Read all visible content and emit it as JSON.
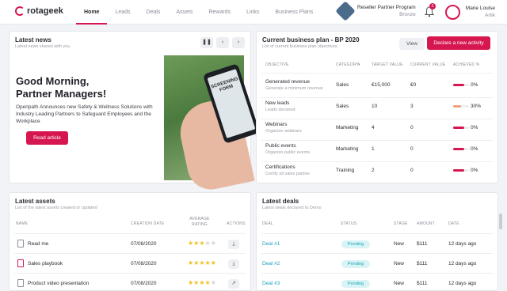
{
  "brand": {
    "name": "rotageek",
    "color": "#d6174f"
  },
  "nav": {
    "items": [
      "Home",
      "Leads",
      "Deals",
      "Assets",
      "Rewards",
      "Links",
      "Business Plans"
    ],
    "active": "Home"
  },
  "partner": {
    "program": "Reseller Partner Program",
    "level": "Bronze"
  },
  "notifications": {
    "count": "3"
  },
  "user": {
    "name": "Marie Louise",
    "company": "Artik"
  },
  "news": {
    "title": "Latest news",
    "subtitle": "Latest news shared with you",
    "headline_1": "Good Morning,",
    "headline_2": "Partner Managers!",
    "body": "Openpath Announces new Safety & Wellness Solutions with Industry Leading Partners to Safeguard Employees and the Workplace",
    "cta": "Read article",
    "image_caption": "SCREENING FORM",
    "controls": {
      "pause": "pause-icon",
      "prev": "chevron-left-icon",
      "next": "chevron-right-icon"
    }
  },
  "business_plan": {
    "title": "Current business plan - BP 2020",
    "subtitle": "List of current business plan objectives",
    "view_label": "View",
    "declare_label": "Declare a new activity",
    "columns": [
      "Objective",
      "Category",
      "Target value",
      "Current value",
      "Achieved %"
    ],
    "rows": [
      {
        "name": "Generated revenue",
        "desc": "Generate a minimum revenue",
        "category": "Sales",
        "target": "€15,000",
        "current": "€0",
        "achieved": "0%",
        "pct": 0
      },
      {
        "name": "New leads",
        "desc": "Leads declared",
        "category": "Sales",
        "target": "10",
        "current": "3",
        "achieved": "30%",
        "pct": 30
      },
      {
        "name": "Webinars",
        "desc": "Organize webinars",
        "category": "Marketing",
        "target": "4",
        "current": "0",
        "achieved": "0%",
        "pct": 0
      },
      {
        "name": "Public events",
        "desc": "Organize public events",
        "category": "Marketing",
        "target": "1",
        "current": "0",
        "achieved": "0%",
        "pct": 0
      },
      {
        "name": "Certifications",
        "desc": "Certify all sales partner",
        "category": "Training",
        "target": "2",
        "current": "0",
        "achieved": "0%",
        "pct": 0
      }
    ]
  },
  "assets": {
    "title": "Latest assets",
    "subtitle": "List of the latest assets created or updated",
    "columns": [
      "Name",
      "Creation date",
      "Average rating",
      "Actions"
    ],
    "rows": [
      {
        "name": "Read me",
        "date": "07/08/2020",
        "rating": 3,
        "action": "download-icon",
        "icon": "document-icon"
      },
      {
        "name": "Sales playbook",
        "date": "07/08/2020",
        "rating": 5,
        "action": "download-icon",
        "icon": "pdf-icon"
      },
      {
        "name": "Product video presentation",
        "date": "07/08/2020",
        "rating": 4,
        "action": "external-link-icon",
        "icon": "video-icon"
      }
    ]
  },
  "deals": {
    "title": "Latest deals",
    "subtitle": "Latest deals declared to Demo",
    "columns": [
      "Deal",
      "Status",
      "Stage",
      "Amount",
      "Date"
    ],
    "rows": [
      {
        "deal": "Deal #1",
        "status": "Pending",
        "stage": "New",
        "amount": "$111",
        "date": "12 days ago"
      },
      {
        "deal": "Deal #2",
        "status": "Pending",
        "stage": "New",
        "amount": "$111",
        "date": "12 days ago"
      },
      {
        "deal": "Deal #3",
        "status": "Pending",
        "stage": "New",
        "amount": "$111",
        "date": "12 days ago"
      }
    ]
  },
  "colors": {
    "accent": "#d6174f",
    "bar_zero": "#d6174f",
    "bar_partial": "#f0a07a",
    "pill": "#1aa6b0"
  }
}
